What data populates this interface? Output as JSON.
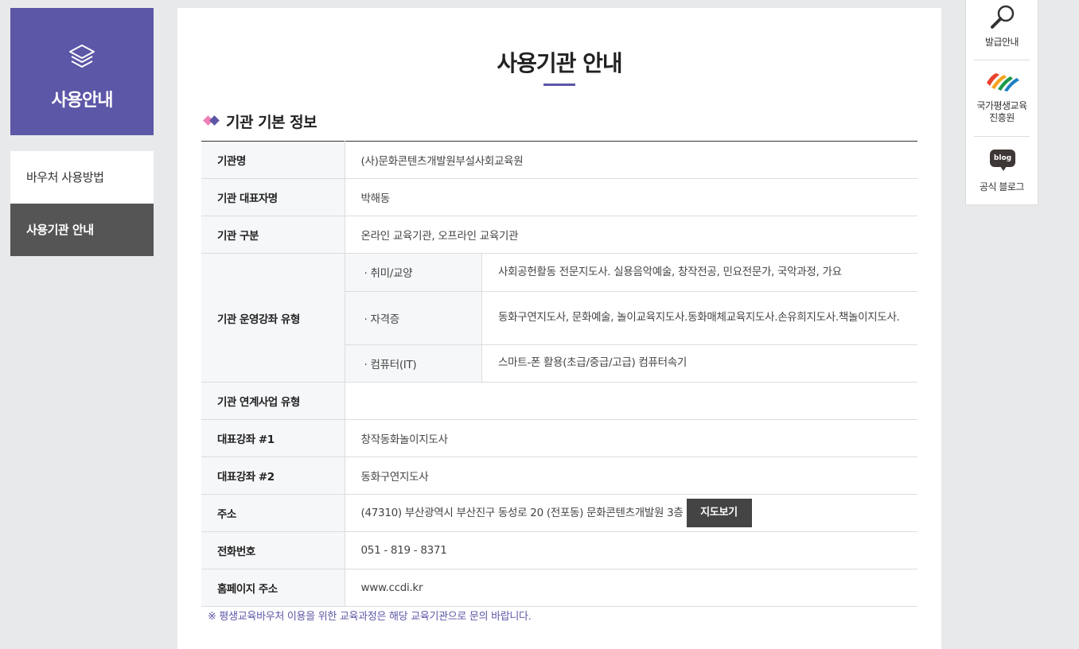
{
  "sidebar": {
    "banner_title": "사용안내",
    "banner_icon": "layers-icon",
    "menu": [
      {
        "label": "바우처 사용방법",
        "active": false
      },
      {
        "label": "사용기관 안내",
        "active": true
      }
    ]
  },
  "main": {
    "page_title": "사용기관 안내",
    "section_title": "기관 기본 정보",
    "rows": {
      "name": {
        "label": "기관명",
        "value": "(사)문화콘텐츠개발원부설사회교육원"
      },
      "rep": {
        "label": "기관 대표자명",
        "value": "박해동"
      },
      "type": {
        "label": "기관 구분",
        "value": "온라인 교육기관, 오프라인 교육기관"
      },
      "courses": {
        "label": "기관 운영강좌 유형",
        "items": [
          {
            "category": "· 취미/교양",
            "desc": "사회공헌활동 전문지도사. 실용음악예술, 창작전공, 민요전문가, 국악과정, 가요"
          },
          {
            "category": "· 자격증",
            "desc": "동화구연지도사, 문화예술, 놀이교육지도사.동화매체교육지도사.손유희지도사.책놀이지도사."
          },
          {
            "category": "· 컴퓨터(IT)",
            "desc": "스마트-폰 활용(초급/중급/고급) 컴퓨터속기"
          }
        ]
      },
      "linked": {
        "label": "기관 연계사업 유형",
        "value": ""
      },
      "course1": {
        "label": "대표강좌 #1",
        "value": "창작동화놀이지도사"
      },
      "course2": {
        "label": "대표강좌 #2",
        "value": "동화구연지도사"
      },
      "address": {
        "label": "주소",
        "value": "(47310) 부산광역시 부산진구 동성로 20 (전포동) 문화콘텐츠개발원 3층",
        "button": "지도보기"
      },
      "phone": {
        "label": "전화번호",
        "value": "051 - 819 - 8371"
      },
      "homepage": {
        "label": "홈페이지 주소",
        "value": "www.ccdi.kr"
      }
    },
    "note": "※ 평생교육바우처 이용을 위한 교육과정은 해당 교육기관으로 문의 바랍니다."
  },
  "quick_menu": {
    "items": [
      {
        "label": "발급안내",
        "icon": "magnifier-icon"
      },
      {
        "label": "국가평생교육\n진흥원",
        "icon": "nile-logo-icon"
      },
      {
        "label": "공식 블로그",
        "icon": "blog-icon",
        "badge": "blog"
      }
    ]
  },
  "colors": {
    "accent": "#5c57a7",
    "pink": "#f07fb8",
    "active_menu": "#555555"
  }
}
